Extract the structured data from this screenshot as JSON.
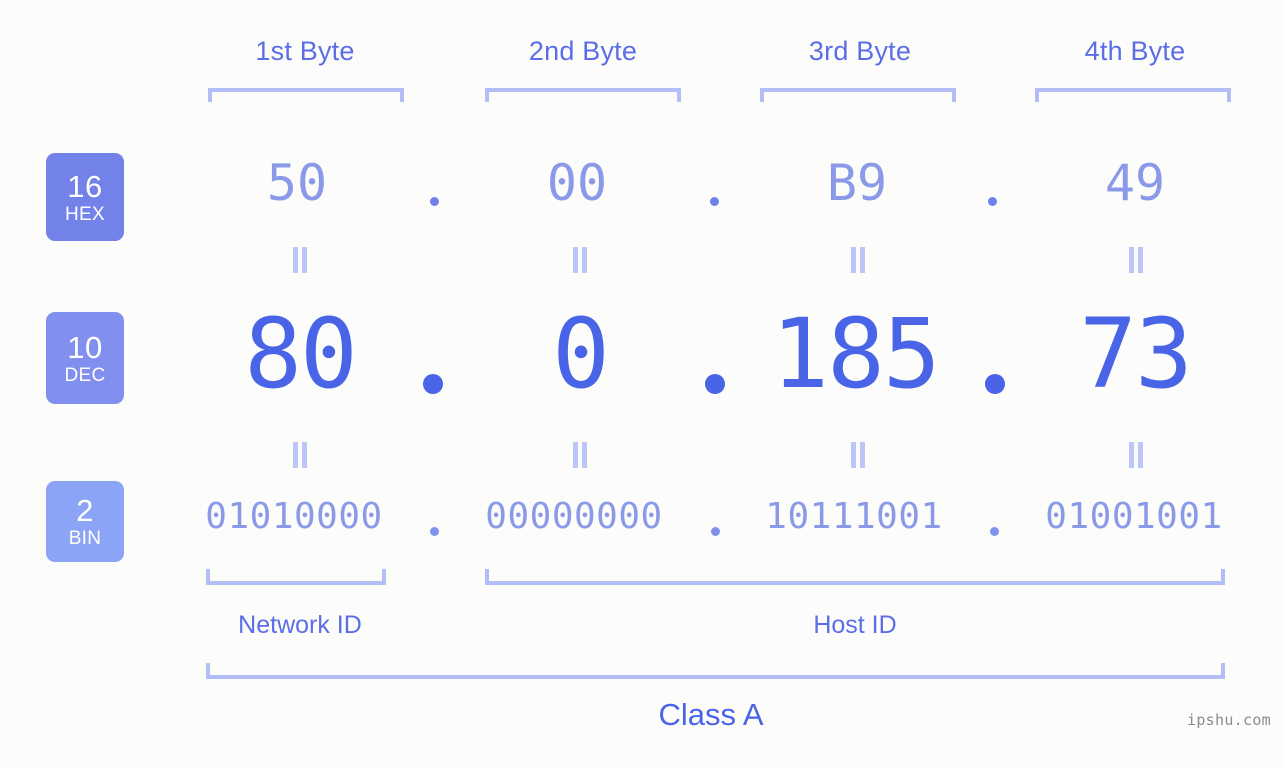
{
  "background_color": "#fcfdfa",
  "accent_color": "#4a64e8",
  "headers": [
    {
      "label": "1st Byte"
    },
    {
      "label": "2nd Byte"
    },
    {
      "label": "3rd Byte"
    },
    {
      "label": "4th Byte"
    }
  ],
  "radix_badges": [
    {
      "num": "16",
      "sub": "HEX",
      "color": "#7382e8"
    },
    {
      "num": "10",
      "sub": "DEC",
      "color": "#8190ef"
    },
    {
      "num": "2",
      "sub": "BIN",
      "color": "#8ba4f5"
    }
  ],
  "rows": {
    "hex": {
      "values": [
        "50",
        "00",
        "B9",
        "49"
      ],
      "separator": "."
    },
    "dec": {
      "values": [
        "80",
        "0",
        "185",
        "73"
      ],
      "separator": "."
    },
    "bin": {
      "values": [
        "01010000",
        "00000000",
        "10111001",
        "01001001"
      ],
      "separator": "."
    }
  },
  "equals_marker": "=",
  "segments": {
    "network_id": "Network ID",
    "host_id": "Host ID"
  },
  "class_label": "Class A",
  "watermark": "ipshu.com"
}
